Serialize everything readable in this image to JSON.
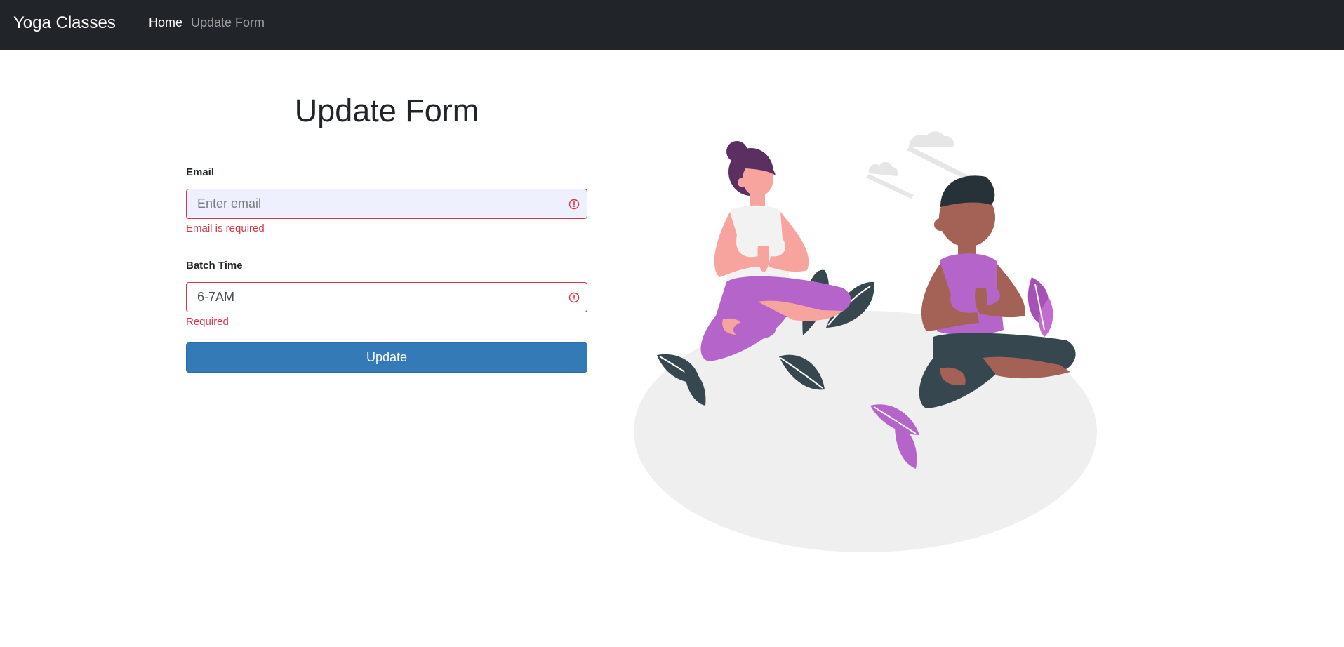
{
  "navbar": {
    "brand": "Yoga Classes",
    "links": [
      {
        "label": "Home",
        "active": true
      },
      {
        "label": "Update Form",
        "active": false
      }
    ]
  },
  "form": {
    "title": "Update Form",
    "email": {
      "label": "Email",
      "value": "",
      "placeholder": "Enter email",
      "error": "Email is required"
    },
    "batch_time": {
      "label": "Batch Time",
      "value": "6-7AM",
      "error": "Required"
    },
    "submit_label": "Update"
  },
  "colors": {
    "navbar_bg": "#212529",
    "error": "#dc3545",
    "button": "#337ab7",
    "email_autofill_bg": "#eef0fd",
    "illustration_purple": "#b565c9",
    "illustration_dark": "#37474f"
  },
  "illustration": {
    "icon": "yoga-meditation-illustration"
  }
}
